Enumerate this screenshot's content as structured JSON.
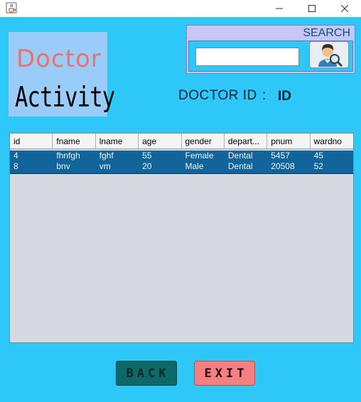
{
  "window": {
    "icons": {
      "app": "java-cup-icon",
      "minimize": "minimize-icon",
      "maximize": "maximize-icon",
      "close": "close-icon"
    }
  },
  "title_panel": {
    "line1": "Doctor",
    "line2": "Activity"
  },
  "search": {
    "title": "SEARCH",
    "input_value": "",
    "button_icon": "doctor-search-icon"
  },
  "doctor_id": {
    "label": "DOCTOR ID",
    "separator": ":",
    "value": "ID"
  },
  "table": {
    "columns": [
      "id",
      "fname",
      "lname",
      "age",
      "gender",
      "depart...",
      "pnum",
      "wardno"
    ],
    "rows": [
      [
        "4",
        "fhnfgh",
        "fghf",
        "55",
        "Female",
        "Dental",
        "5457",
        "45"
      ],
      [
        "8",
        "bnv",
        "vm",
        "20",
        "Male",
        "Dental",
        "20508",
        "52"
      ]
    ]
  },
  "buttons": {
    "back": "BACK",
    "exit": "EXIT"
  },
  "colors": {
    "background": "#2ec8f8",
    "title_panel": "#99ccf8",
    "doctor_text": "#f07070",
    "search_panel": "#c6c6f8",
    "row_selected": "#11659a",
    "back_button": "#0e6868",
    "exit_button": "#f58080"
  }
}
